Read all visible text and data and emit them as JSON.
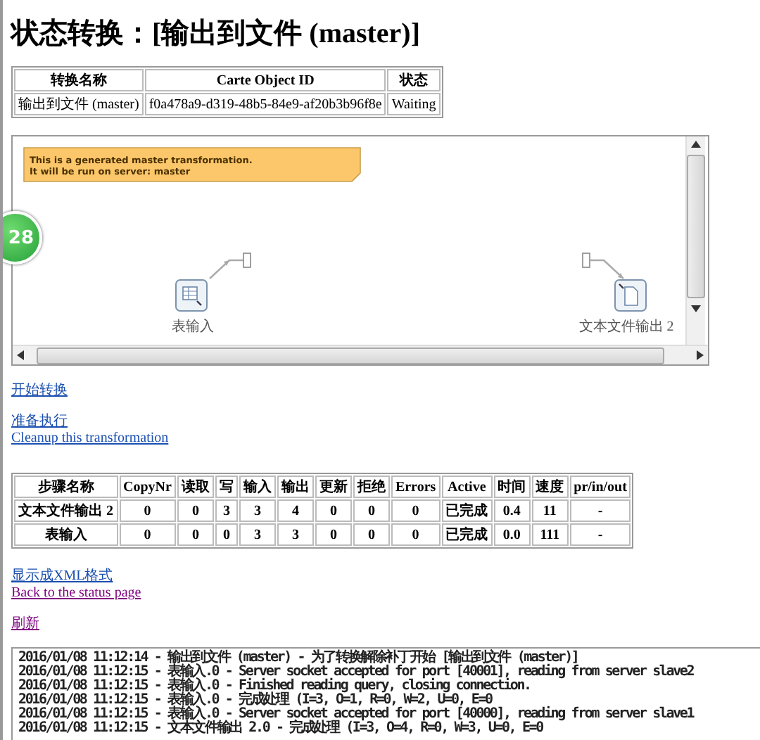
{
  "title": "状态转换：[输出到文件 (master)]",
  "summary": {
    "columns": [
      "转换名称",
      "Carte Object ID",
      "状态"
    ],
    "row": [
      "输出到文件 (master)",
      "f0a478a9-d319-48b5-84e9-af20b3b96f8e",
      "Waiting"
    ]
  },
  "canvas": {
    "note": [
      "This is a generated master transformation.",
      "It will be run on server: master"
    ],
    "steps": [
      {
        "name": "表输入",
        "kind": "table-input"
      },
      {
        "name": "文本文件输出 2",
        "kind": "file-output"
      }
    ]
  },
  "badge": "28",
  "actions_top": [
    {
      "label": "开始转换",
      "visited": false
    }
  ],
  "actions_mid": [
    {
      "label": "准备执行",
      "visited": false
    },
    {
      "label": "Cleanup this transformation",
      "visited": false
    }
  ],
  "steps_table": {
    "columns": [
      "步骤名称",
      "CopyNr",
      "读取",
      "写",
      "输入",
      "输出",
      "更新",
      "拒绝",
      "Errors",
      "Active",
      "时间",
      "速度",
      "pr/in/out"
    ],
    "rows": [
      [
        "文本文件输出 2",
        "0",
        "0",
        "3",
        "3",
        "4",
        "0",
        "0",
        "0",
        "已完成",
        "0.4",
        "11",
        "-"
      ],
      [
        "表输入",
        "0",
        "0",
        "0",
        "3",
        "3",
        "0",
        "0",
        "0",
        "已完成",
        "0.0",
        "111",
        "-"
      ]
    ]
  },
  "actions_bottom": [
    {
      "label": "显示成XML格式",
      "visited": false
    },
    {
      "label": "Back to the status page",
      "visited": true
    }
  ],
  "refresh": {
    "label": "刷新",
    "visited": true
  },
  "log": [
    "2016/01/08 11:12:14 - 输出到文件 (master) - 为了转换解除补丁开始  [输出到文件 (master)]",
    "2016/01/08 11:12:15 - 表输入.0 - Server socket accepted for port [40001], reading from server slave2",
    "2016/01/08 11:12:15 - 表输入.0 - Finished reading query, closing connection.",
    "2016/01/08 11:12:15 - 表输入.0 - 完成处理 (I=3, O=1, R=0, W=2, U=0, E=0",
    "2016/01/08 11:12:15 - 表输入.0 - Server socket accepted for port [40000], reading from server slave1",
    "2016/01/08 11:12:15 - 文本文件输出 2.0 - 完成处理 (I=3, O=4, R=0, W=3, U=0, E=0"
  ]
}
